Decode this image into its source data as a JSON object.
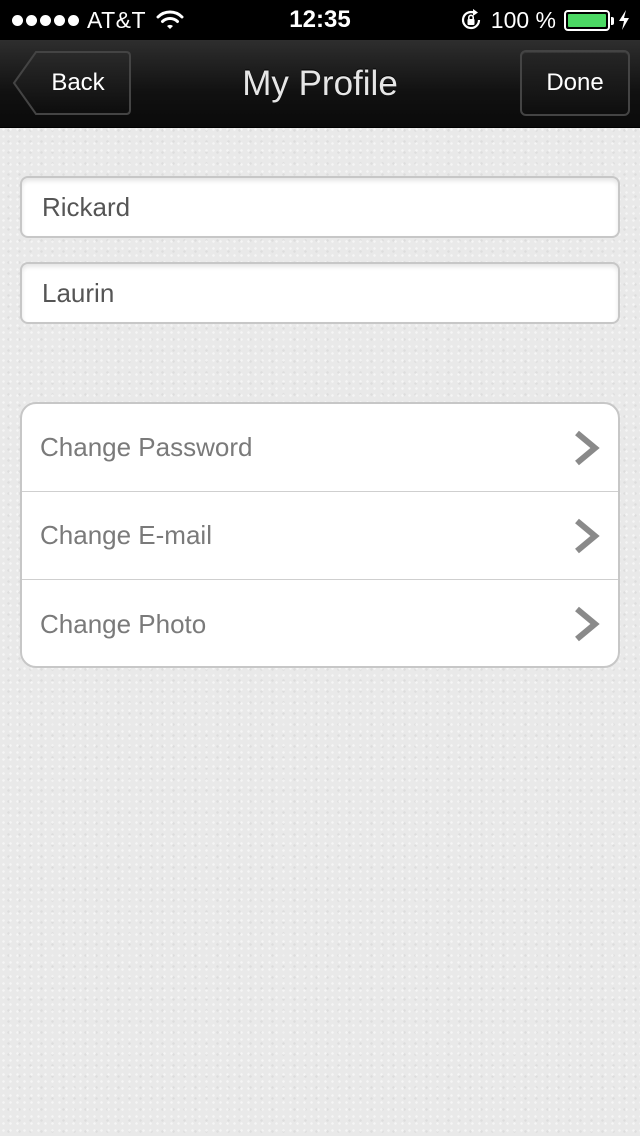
{
  "status_bar": {
    "carrier": "AT&T",
    "time": "12:35",
    "battery_percent": "100 %",
    "battery_level": 1.0,
    "signal_bars": 5,
    "icons": [
      "signal-dots-icon",
      "wifi-icon",
      "rotation-lock-icon",
      "battery-icon",
      "charging-bolt-icon"
    ]
  },
  "nav_bar": {
    "title": "My Profile",
    "back_label": "Back",
    "done_label": "Done"
  },
  "form": {
    "first_name": "Rickard",
    "last_name": "Laurin"
  },
  "settings": {
    "items": [
      {
        "label": "Change Password",
        "icon": "chevron-right-icon"
      },
      {
        "label": "Change E-mail",
        "icon": "chevron-right-icon"
      },
      {
        "label": "Change Photo",
        "icon": "chevron-right-icon"
      }
    ]
  },
  "colors": {
    "battery_fill": "#4cd964",
    "nav_background": "#111111",
    "page_background": "#e9e9e9"
  }
}
